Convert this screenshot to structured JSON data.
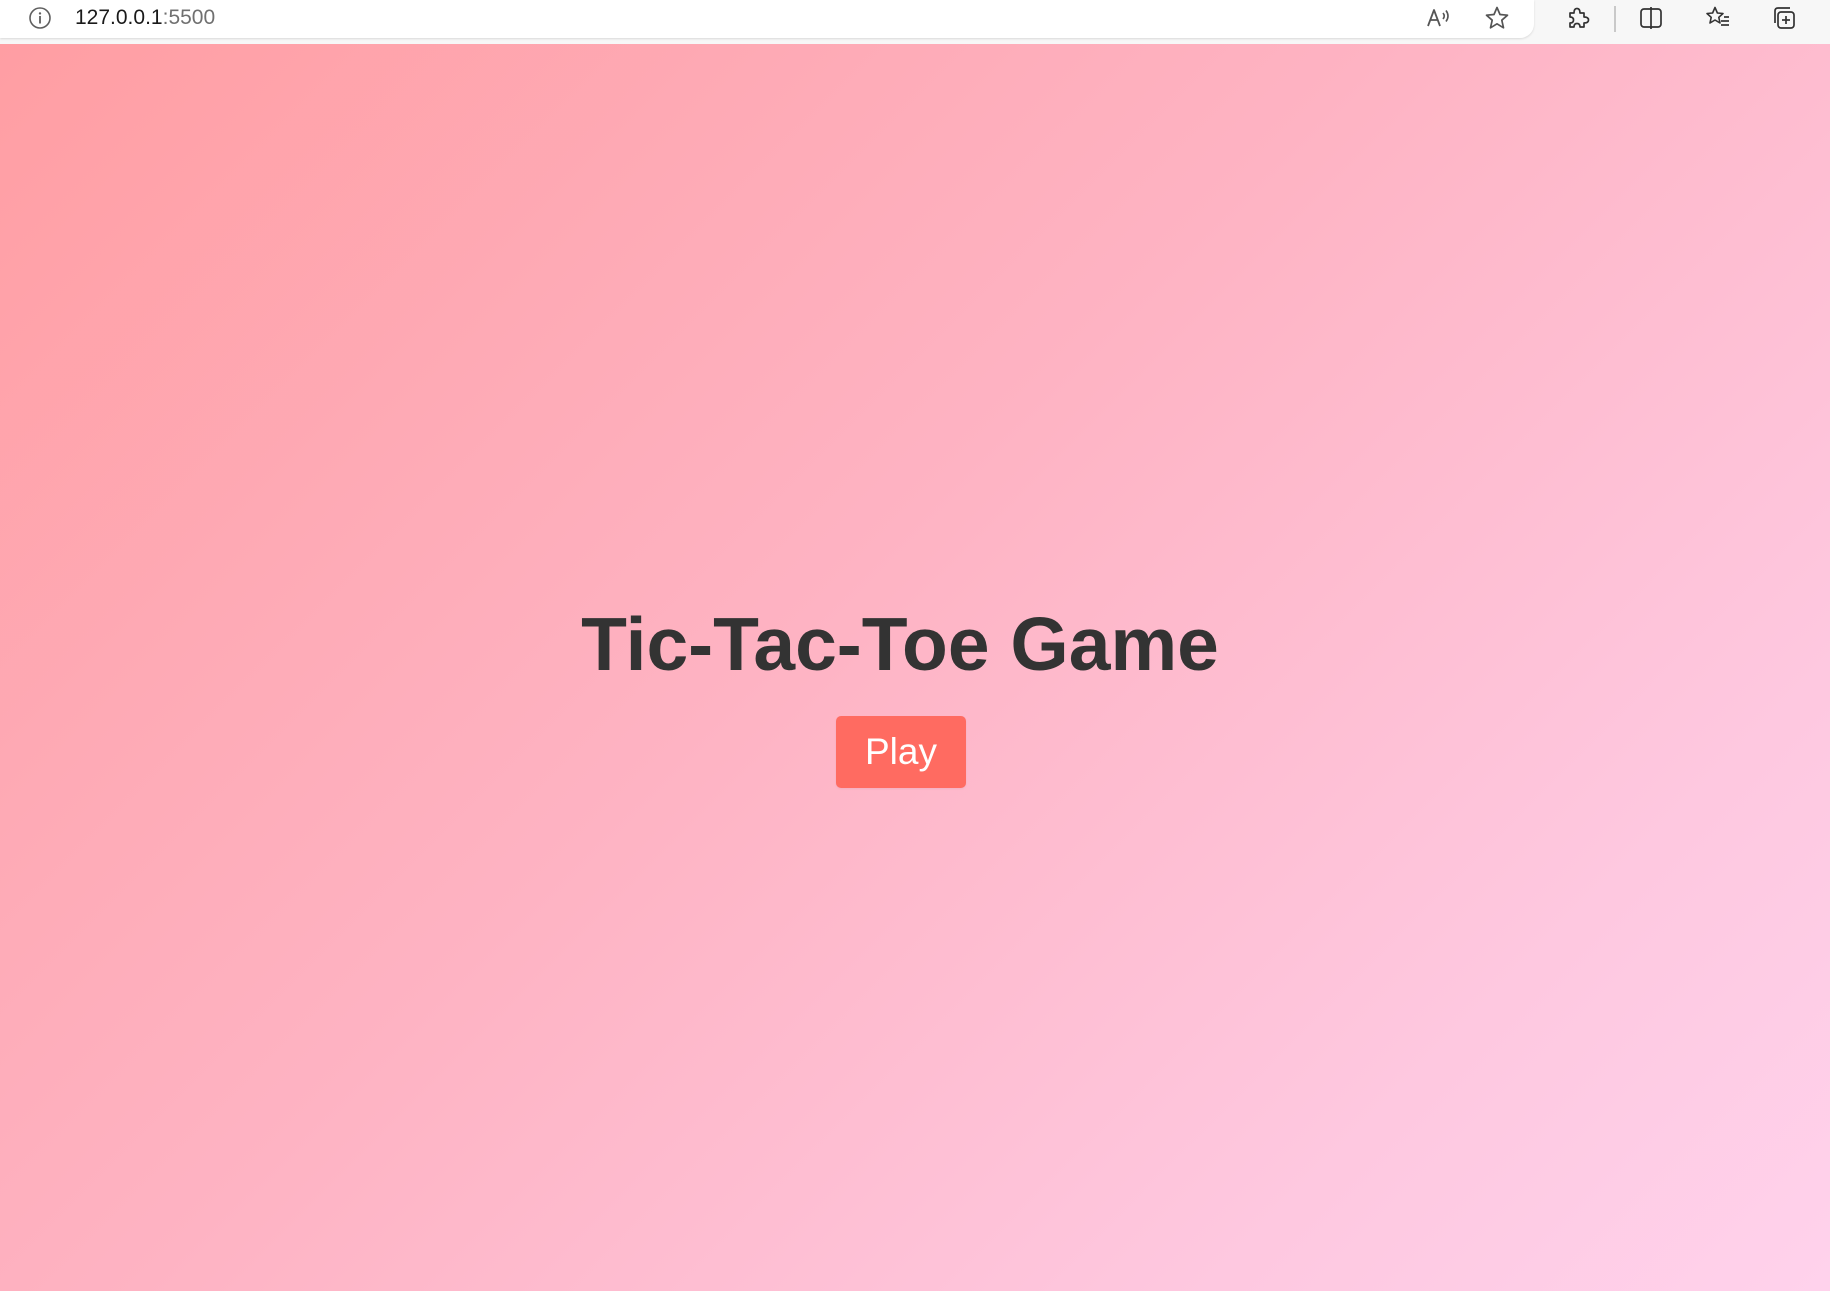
{
  "browser": {
    "url_host": "127.0.0.1",
    "url_separator": ":",
    "url_port": "5500",
    "icons": {
      "site_info": "info-icon",
      "read_aloud": "read-aloud-icon",
      "favorite": "star-icon",
      "extensions": "puzzle-icon",
      "split_screen": "split-screen-icon",
      "favorites": "favorites-list-icon",
      "collections": "collections-icon"
    }
  },
  "page": {
    "title": "Tic-Tac-Toe Game",
    "play_label": "Play",
    "colors": {
      "background_start": "#ff9ea3",
      "background_end": "#ffd2ec",
      "title": "#333333",
      "button": "#ff6b61",
      "button_text": "#ffffff"
    }
  }
}
